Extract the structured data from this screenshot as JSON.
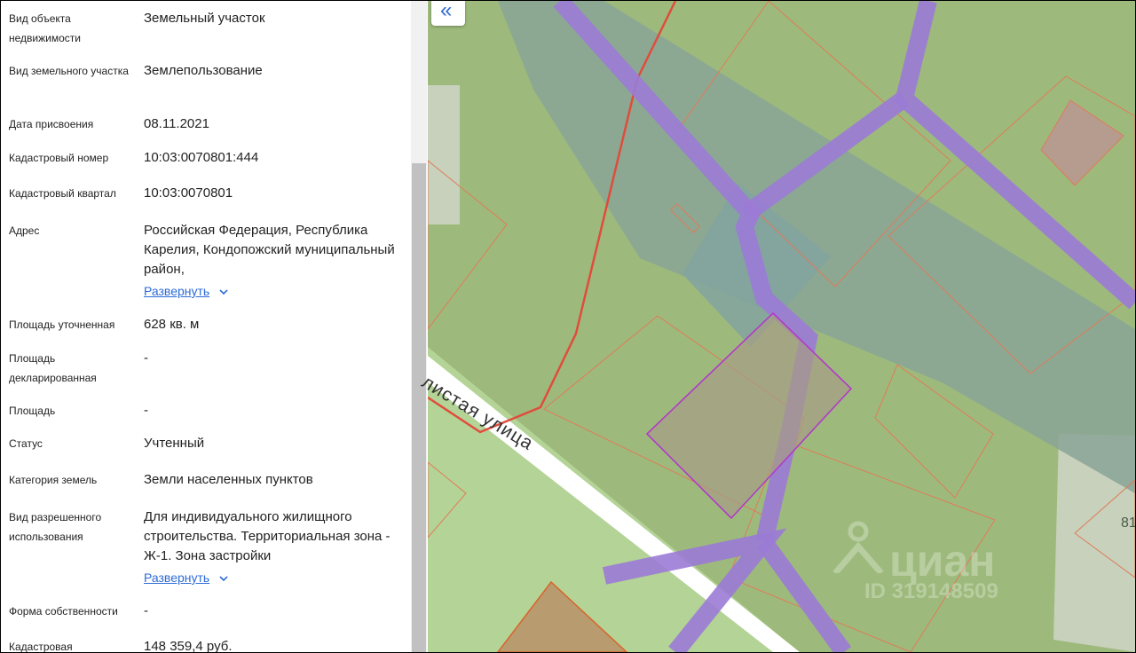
{
  "properties": [
    {
      "label": "Вид объекта недвижимости",
      "value": "Земельный участок"
    },
    {
      "label": "Вид земельного участка",
      "value": "Землепользование"
    },
    {
      "label": "Дата присвоения",
      "value": "08.11.2021"
    },
    {
      "label": "Кадастровый номер",
      "value": "10:03:0070801:444"
    },
    {
      "label": "Кадастровый квартал",
      "value": "10:03:0070801"
    },
    {
      "label": "Адрес",
      "value": "Российская Федерация, Республика Карелия, Кондопожский муниципальный район,"
    },
    {
      "label": "Площадь уточненная",
      "value": "628 кв. м"
    },
    {
      "label": "Площадь декларированная",
      "value": "-"
    },
    {
      "label": "Площадь",
      "value": "-"
    },
    {
      "label": "Статус",
      "value": "Учтенный"
    },
    {
      "label": "Категория земель",
      "value": "Земли населенных пунктов"
    },
    {
      "label": "Вид разрешенного использования",
      "value": "Для индивидуального жилищного строительства. Территориальная зона - Ж-1. Зона застройки"
    },
    {
      "label": "Форма собственности",
      "value": "-"
    },
    {
      "label": "Кадастровая",
      "value": "148 359,4 руб."
    }
  ],
  "expand_label": "Развернуть",
  "collapse_icon": "«",
  "map": {
    "street_label": "листая улица",
    "watermark_brand": "циан",
    "watermark_id": "ID 319148509",
    "edge_number": "81"
  }
}
